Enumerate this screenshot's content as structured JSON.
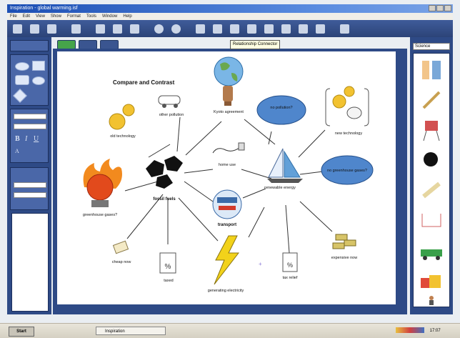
{
  "window": {
    "title": "Inspiration - global warming.isf"
  },
  "menu": [
    "File",
    "Edit",
    "View",
    "Show",
    "Format",
    "Tools",
    "Window",
    "Help"
  ],
  "tooltip": "Relationship Connector",
  "diagram": {
    "title": "Compare and Contrast",
    "nodes": {
      "other_pollution": "other pollution",
      "kyoto": "Kyoto agreement",
      "no_pollution": "no pollution?",
      "new_technology": "new technology",
      "old_technology": "old technology",
      "home_use": "home use",
      "no_greenhouse": "no greenhouse gases?",
      "greenhouse": "greenhouse gases?",
      "fossil_fuels": "fossil fuels",
      "renewable": "renewable energy",
      "transport": "transport",
      "cheap": "cheap now",
      "taxed": "taxed",
      "electricity": "generating electricity",
      "tax_relief": "tax relief",
      "expensive": "expensive now"
    }
  },
  "right_panel": {
    "category": "Science"
  },
  "taskbar": {
    "start": "Start",
    "task": "Inspiration",
    "clock": "17:07"
  },
  "colors": {
    "accent": "#2e4a86",
    "bubble": "#4f86cc",
    "canvas": "#ffffff"
  }
}
